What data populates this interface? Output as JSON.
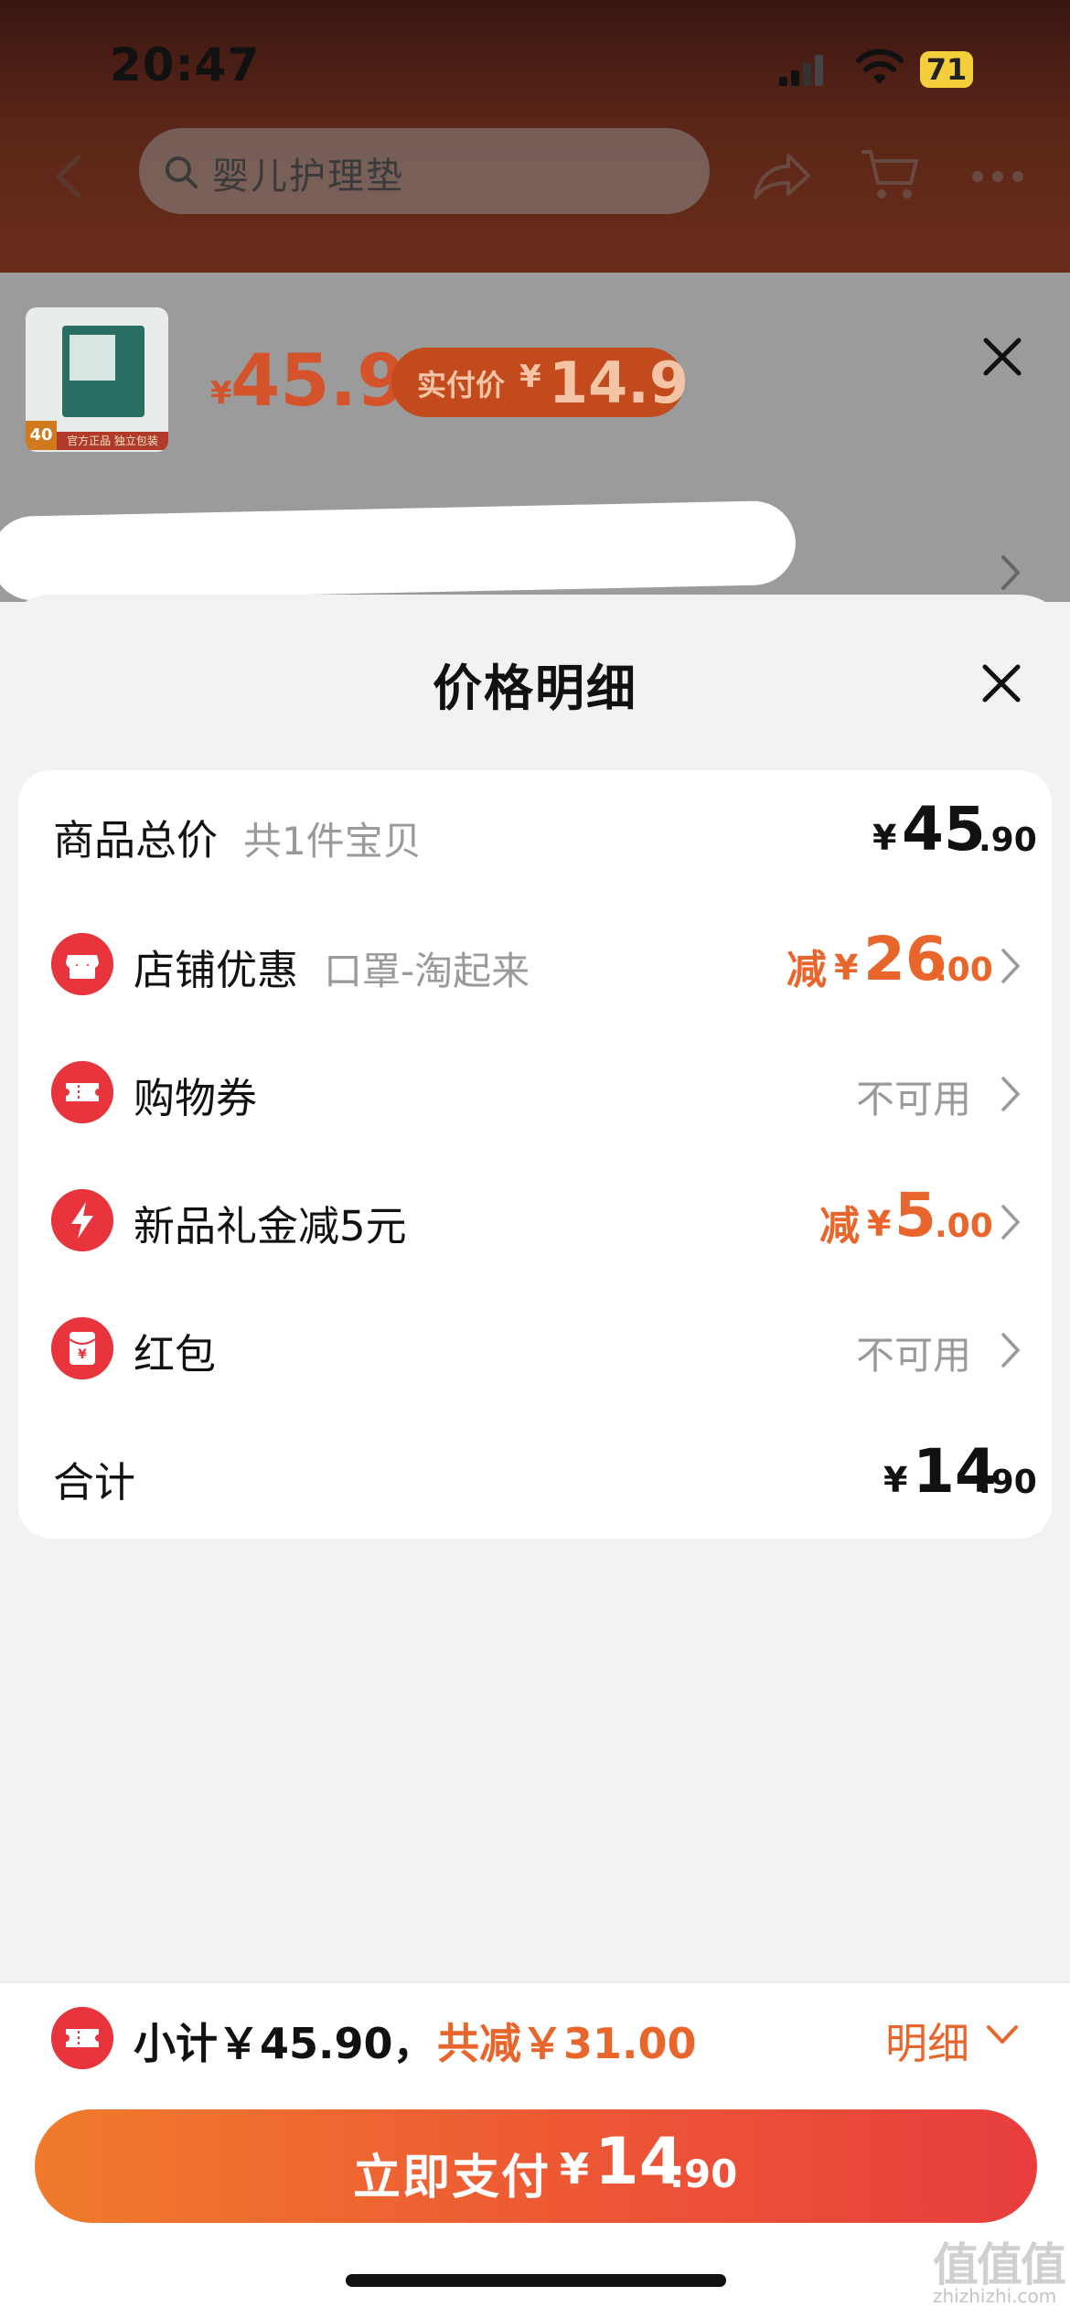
{
  "status_bar": {
    "time": "20:47",
    "battery": "71"
  },
  "nav": {
    "search_text": "婴儿护理垫"
  },
  "product_header": {
    "yen": "¥",
    "price": "45.9",
    "actual_label": "实付价",
    "actual_yen": "¥",
    "actual_price": "14.9",
    "thumb_badge": "40",
    "thumb_strip": "官方正品 独立包装"
  },
  "sheet": {
    "title": "价格明细"
  },
  "rows": {
    "total": {
      "label": "商品总价",
      "sub": "共1件宝贝",
      "yen": "¥",
      "int": "45",
      "dec": ".90"
    },
    "shop": {
      "label": "店铺优惠",
      "sub": "口罩-淘起来",
      "jian": "减",
      "yen": "¥",
      "int": "26",
      "dec": ".00"
    },
    "coupon": {
      "label": "购物券",
      "value": "不可用"
    },
    "gift": {
      "label": "新品礼金减5元",
      "jian": "减",
      "yen": "¥",
      "int": "5",
      "dec": ".00"
    },
    "packet": {
      "label": "红包",
      "value": "不可用",
      "icon_glyph": "¥"
    },
    "sum": {
      "label": "合计",
      "yen": "¥",
      "int": "14",
      "dec": ".90"
    }
  },
  "bottom": {
    "subtotal": "小计￥45.90，",
    "discount_total": "共减￥31.00",
    "detail_label": "明细",
    "pay_label": "立即支付",
    "pay_yen": "¥",
    "pay_int": "14",
    "pay_dec": ".90"
  },
  "watermark": {
    "logo": "值值值",
    "url": "zhizhizhi.com"
  },
  "colors": {
    "accent": "#e8662c",
    "brand_red": "#e8343c",
    "pay_gradient_start": "#f07b2c",
    "pay_gradient_end": "#e83e3e"
  }
}
